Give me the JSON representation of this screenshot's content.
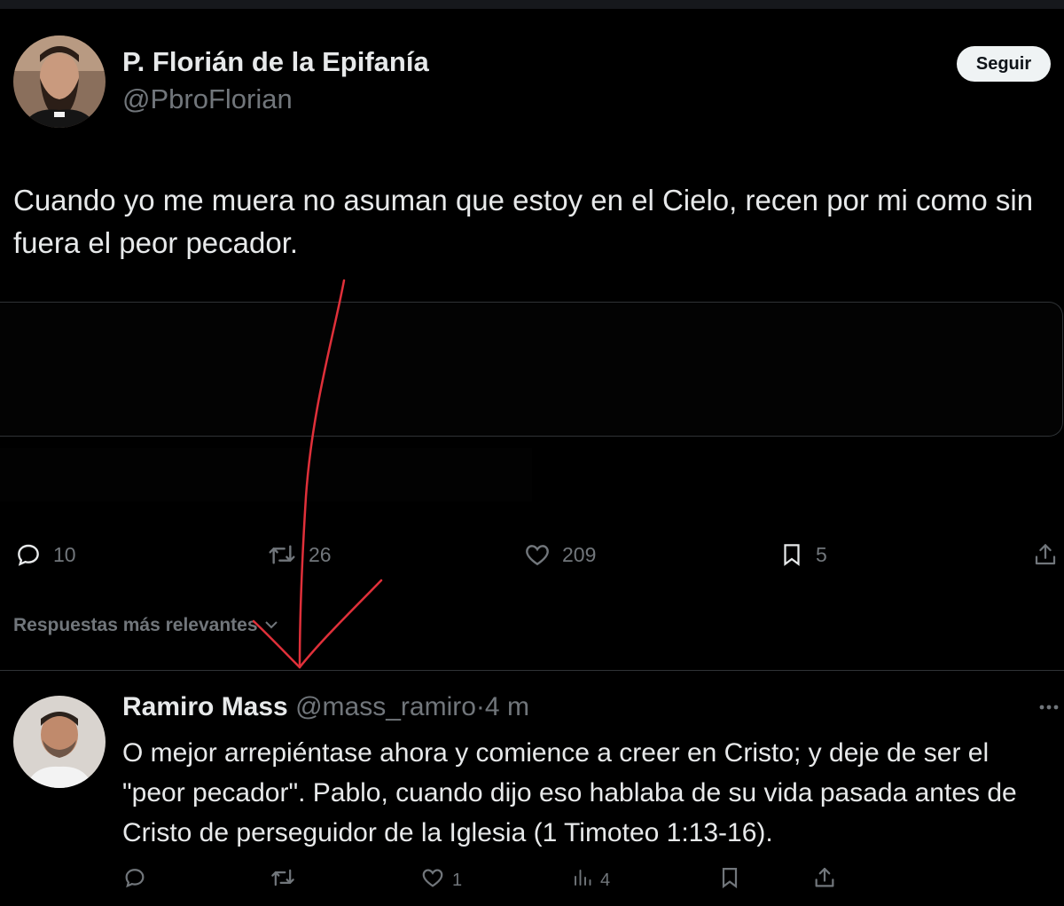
{
  "tweet": {
    "author_name": "P. Florián de la Epifanía",
    "author_handle": "@PbroFlorian",
    "follow_label": "Seguir",
    "text": "Cuando yo me muera no asuman que estoy en el Cielo, recen por mi como sin fuera el peor pecador.",
    "stats": {
      "replies": "10",
      "retweets": "26",
      "likes": "209",
      "bookmarks": "5"
    }
  },
  "replies_filter": {
    "label": "Respuestas más relevantes"
  },
  "reply": {
    "author_name": "Ramiro Mass",
    "author_handle": "@mass_ramiro",
    "separator": "·",
    "time": "4 m",
    "text": "O mejor arrepiéntase ahora y comience a creer en Cristo; y deje de ser el \"peor pecador\". Pablo, cuando dijo eso hablaba de su vida pasada antes de Cristo de perseguidor de la Iglesia (1 Timoteo 1:13-16).",
    "stats": {
      "likes": "1",
      "views": "4"
    }
  },
  "colors": {
    "background": "#000000",
    "text_primary": "#e7e9ea",
    "text_secondary": "#71767b",
    "divider": "#2f3336",
    "annotation_arrow": "#e0303a"
  },
  "icons": [
    "reply-icon",
    "retweet-icon",
    "like-icon",
    "bookmark-icon",
    "share-icon",
    "views-icon",
    "more-icon",
    "chevron-down-icon"
  ]
}
